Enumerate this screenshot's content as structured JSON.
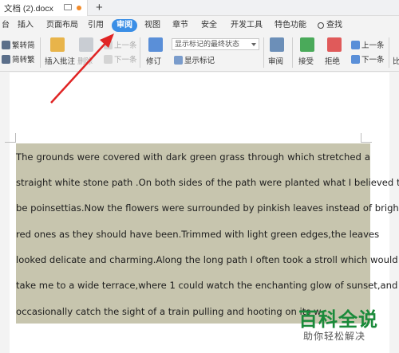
{
  "titlebar": {
    "doc_title": "文档 (2).docx",
    "add_tab": "+"
  },
  "menu": {
    "tabs": [
      "插入",
      "页面布局",
      "引用",
      "审阅",
      "视图",
      "章节",
      "安全",
      "开发工具",
      "特色功能",
      "查找"
    ],
    "left_partial": "台",
    "active_index": 3,
    "active_color": "#3a8ee6"
  },
  "ribbon": {
    "fan_zhuan_jian": "繁转简",
    "jian_zhuan_fan": "简转繁",
    "insert_comment": "插入批注",
    "delete": "删除",
    "prev_comment": "上一条",
    "next_comment": "下一条",
    "track_changes": "修订",
    "display_markup": "显示标记",
    "markup_dropdown": "显示标记的最终状态",
    "review": "审阅",
    "accept": "接受",
    "reject": "拒绝",
    "prev_change": "上一条",
    "next_change": "下一条",
    "compare_partial": "比"
  },
  "document": {
    "lines": [
      "The grounds were covered with dark green grass through which stretched a",
      "straight white stone path .On both sides of the path were planted what I believed to",
      "be poinsettias.Now the flowers were surrounded by pinkish leaves instead of bright",
      "red ones as they should have been.Trimmed with light green edges,the leaves",
      "looked delicate and charming.Along the long path I often took a stroll which would",
      "take me to a wide terrace,where 1 could watch the enchanting glow of sunset,and",
      "occasionally catch the sight of a train pulling and hooting on its w"
    ],
    "highlight_color": "#c7c5ae"
  },
  "watermark": {
    "logo": "百科全说",
    "sub": "助你轻松解决"
  }
}
